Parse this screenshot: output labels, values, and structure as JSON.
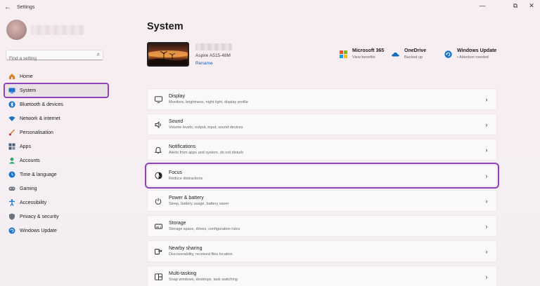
{
  "window": {
    "title": "Settings",
    "back": "←",
    "minimize": "—",
    "maximize": "⧉",
    "close": "✕"
  },
  "search": {
    "placeholder": "Find a setting"
  },
  "sidebar": {
    "items": [
      {
        "label": "Home",
        "icon": "home-icon",
        "color": "#d9822b"
      },
      {
        "label": "System",
        "icon": "system-icon",
        "color": "#1a74c9"
      },
      {
        "label": "Bluetooth & devices",
        "icon": "bluetooth-icon",
        "color": "#1a74c9"
      },
      {
        "label": "Network & internet",
        "icon": "wifi-icon",
        "color": "#1a74c9"
      },
      {
        "label": "Personalisation",
        "icon": "brush-icon",
        "color": "#d9822b"
      },
      {
        "label": "Apps",
        "icon": "apps-icon",
        "color": "#4b5d75"
      },
      {
        "label": "Accounts",
        "icon": "accounts-icon",
        "color": "#2fa36b"
      },
      {
        "label": "Time & language",
        "icon": "globe-clock-icon",
        "color": "#1a74c9"
      },
      {
        "label": "Gaming",
        "icon": "gamepad-icon",
        "color": "#6b7280"
      },
      {
        "label": "Accessibility",
        "icon": "accessibility-icon",
        "color": "#1a74c9"
      },
      {
        "label": "Privacy & security",
        "icon": "shield-icon",
        "color": "#6b7280"
      },
      {
        "label": "Windows Update",
        "icon": "update-icon",
        "color": "#1a74c9"
      }
    ]
  },
  "main": {
    "title": "System",
    "device": {
      "model": "Aspire A515-48M",
      "rename": "Rename"
    },
    "status": [
      {
        "title": "Microsoft 365",
        "sub": "View benefits",
        "icon": "microsoft-365-icon"
      },
      {
        "title": "OneDrive",
        "sub": "Backed up",
        "icon": "onedrive-icon"
      },
      {
        "title": "Windows Update",
        "sub": "• Attention needed",
        "icon": "windows-update-icon"
      }
    ],
    "cards": [
      {
        "title": "Display",
        "desc": "Monitors, brightness, night light, display profile",
        "icon": "display-icon",
        "glyph": "▭"
      },
      {
        "title": "Sound",
        "desc": "Volume levels, output, input, sound devices",
        "icon": "speaker-icon",
        "glyph": "🔈"
      },
      {
        "title": "Notifications",
        "desc": "Alerts from apps and system, do not disturb",
        "icon": "bell-icon",
        "glyph": "🔔"
      },
      {
        "title": "Focus",
        "desc": "Reduce distractions",
        "icon": "focus-icon",
        "glyph": "◐"
      },
      {
        "title": "Power & battery",
        "desc": "Sleep, battery usage, battery saver",
        "icon": "power-icon",
        "glyph": "⏻"
      },
      {
        "title": "Storage",
        "desc": "Storage space, drives, configuration rules",
        "icon": "storage-icon",
        "glyph": "▤"
      },
      {
        "title": "Nearby sharing",
        "desc": "Discoverability, received files location",
        "icon": "nearby-sharing-icon",
        "glyph": "⇄"
      },
      {
        "title": "Multi-tasking",
        "desc": "Snap windows, desktops, task switching",
        "icon": "multitasking-icon",
        "glyph": "❐"
      }
    ],
    "chevron": "›"
  }
}
